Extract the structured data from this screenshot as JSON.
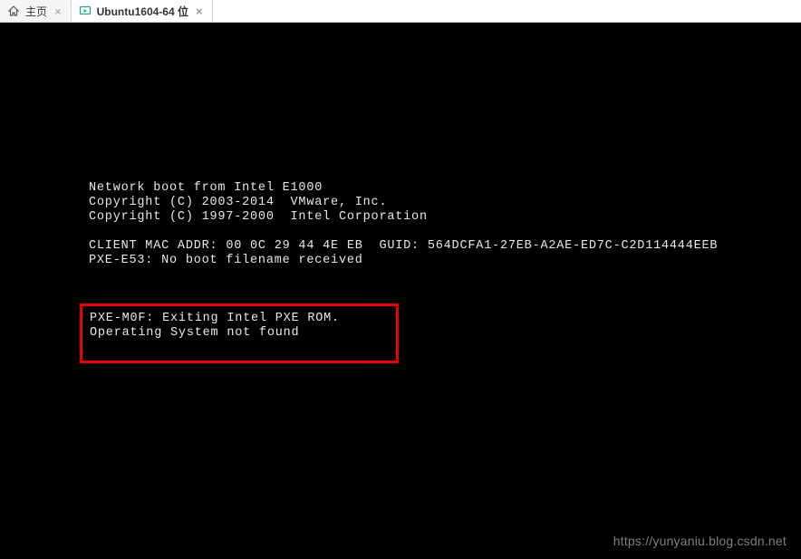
{
  "tabs": {
    "home": {
      "label": "主页"
    },
    "active": {
      "label": "Ubuntu1604-64 位"
    }
  },
  "console": {
    "line1": "Network boot from Intel E1000",
    "line2": "Copyright (C) 2003-2014  VMware, Inc.",
    "line3": "Copyright (C) 1997-2000  Intel Corporation",
    "line4": "CLIENT MAC ADDR: 00 0C 29 44 4E EB  GUID: 564DCFA1-27EB-A2AE-ED7C-C2D114444EEB",
    "line5": "PXE-E53: No boot filename received",
    "line6": "PXE-M0F: Exiting Intel PXE ROM.",
    "line7": "Operating System not found"
  },
  "watermark": "https://yunyaniu.blog.csdn.net"
}
